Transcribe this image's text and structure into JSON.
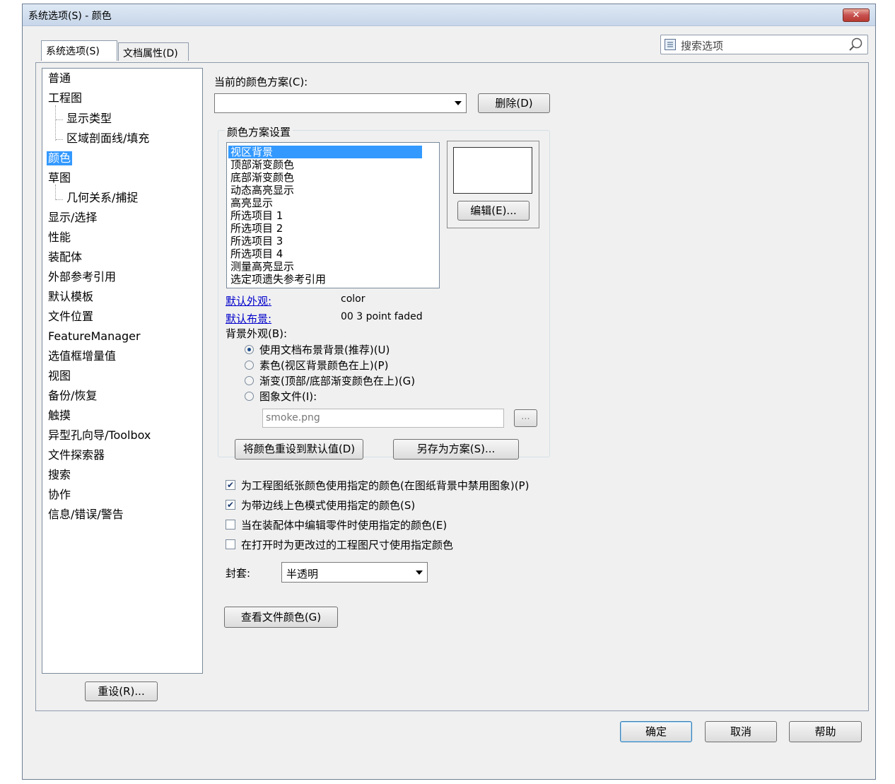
{
  "window": {
    "title": "系统选项(S) - 颜色",
    "close_glyph": "✕"
  },
  "tabs": [
    {
      "label": "系统选项(S)"
    },
    {
      "label": "文档属性(D)"
    }
  ],
  "search": {
    "placeholder": "搜索选项"
  },
  "tree": {
    "items": [
      {
        "label": "普通"
      },
      {
        "label": "工程图"
      },
      {
        "label": "显示类型"
      },
      {
        "label": "区域剖面线/填充"
      },
      {
        "label": "颜色"
      },
      {
        "label": "草图"
      },
      {
        "label": "几何关系/捕捉"
      },
      {
        "label": "显示/选择"
      },
      {
        "label": "性能"
      },
      {
        "label": "装配体"
      },
      {
        "label": "外部参考引用"
      },
      {
        "label": "默认模板"
      },
      {
        "label": "文件位置"
      },
      {
        "label": "FeatureManager"
      },
      {
        "label": "选值框增量值"
      },
      {
        "label": "视图"
      },
      {
        "label": "备份/恢复"
      },
      {
        "label": "触摸"
      },
      {
        "label": "异型孔向导/Toolbox"
      },
      {
        "label": "文件探索器"
      },
      {
        "label": "搜索"
      },
      {
        "label": "协作"
      },
      {
        "label": "信息/错误/警告"
      }
    ],
    "reset_label": "重设(R)..."
  },
  "colors": {
    "current_scheme_label": "当前的颜色方案(C):",
    "current_scheme_value": "",
    "delete_label": "删除(D)",
    "group_title": "颜色方案设置",
    "scheme_items": [
      "视区背景",
      "顶部渐变颜色",
      "底部渐变颜色",
      "动态高亮显示",
      "高亮显示",
      "所选项目 1",
      "所选项目 2",
      "所选项目 3",
      "所选项目 4",
      "测量高亮显示",
      "选定项遗失参考引用"
    ],
    "edit_label": "编辑(E)...",
    "default_appearance_label": "默认外观:",
    "default_appearance_value": "color",
    "default_scene_label": "默认布景:",
    "default_scene_value": "00 3 point faded",
    "bg_appearance_label": "背景外观(B):",
    "radio_options": [
      {
        "label": "使用文档布景背景(推荐)(U)",
        "checked": true
      },
      {
        "label": "素色(视区背景颜色在上)(P)",
        "checked": false
      },
      {
        "label": "渐变(顶部/底部渐变颜色在上)(G)",
        "checked": false
      },
      {
        "label": "图象文件(I):",
        "checked": false
      }
    ],
    "image_file_value": "smoke.png",
    "browse_label": "...",
    "reset_colors_label": "将颜色重设到默认值(D)",
    "save_scheme_label": "另存为方案(S)...",
    "checkboxes": [
      {
        "label": "为工程图纸张颜色使用指定的颜色(在图纸背景中禁用图象)(P)",
        "checked": true
      },
      {
        "label": "为带边线上色模式使用指定的颜色(S)",
        "checked": true
      },
      {
        "label": "当在装配体中编辑零件时使用指定的颜色(E)",
        "checked": false
      },
      {
        "label": "在打开时为更改过的工程图尺寸使用指定颜色",
        "checked": false
      }
    ],
    "envelope_label": "封套:",
    "envelope_value": "半透明",
    "view_doc_colors_label": "查看文件颜色(G)"
  },
  "footer": {
    "ok_label": "确定",
    "cancel_label": "取消",
    "help_label": "帮助"
  },
  "accent_colors": {
    "selection": "#3399ff",
    "link": "#0000cc",
    "close_button": "#c75050"
  }
}
